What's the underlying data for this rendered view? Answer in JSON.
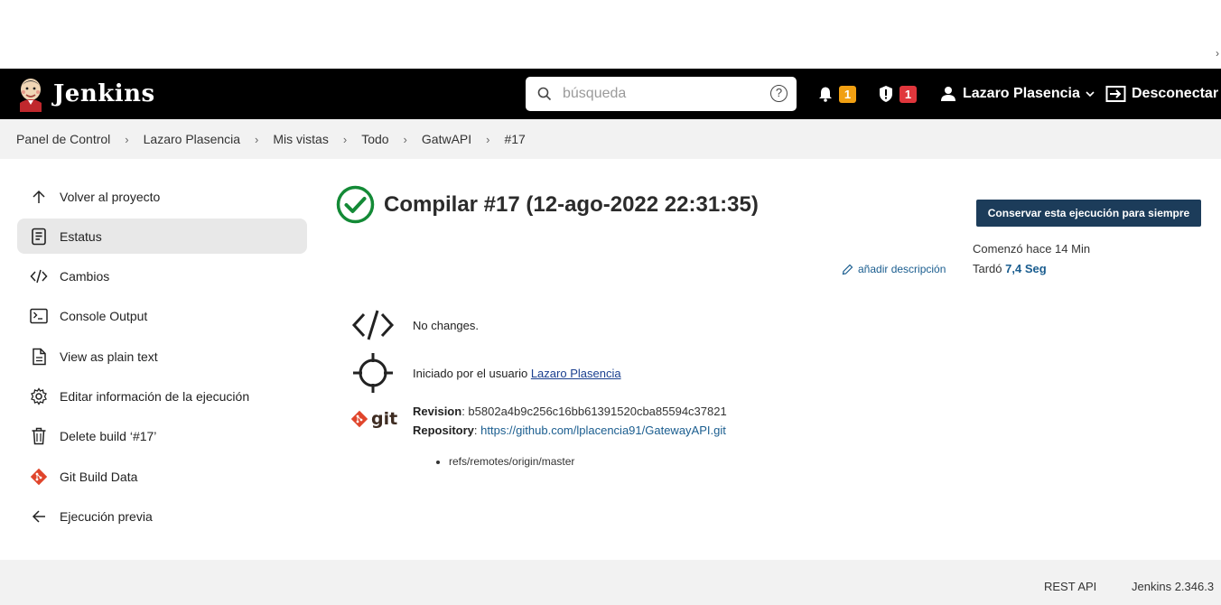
{
  "header": {
    "brand": "Jenkins",
    "search_placeholder": "búsqueda",
    "notifications_count": "1",
    "security_count": "1",
    "user_name": "Lazaro Plasencia",
    "logout_label": "Desconectar"
  },
  "breadcrumb": [
    "Panel de Control",
    "Lazaro Plasencia",
    "Mis vistas",
    "Todo",
    "GatwAPI",
    "#17"
  ],
  "sidebar": {
    "items": [
      {
        "label": "Volver al proyecto",
        "icon": "arrow-up-icon"
      },
      {
        "label": "Estatus",
        "icon": "document-icon"
      },
      {
        "label": "Cambios",
        "icon": "code-icon"
      },
      {
        "label": "Console Output",
        "icon": "terminal-icon"
      },
      {
        "label": "View as plain text",
        "icon": "file-text-icon"
      },
      {
        "label": "Editar información de la ejecución",
        "icon": "gear-icon"
      },
      {
        "label": "Delete build ‘#17’",
        "icon": "trash-icon"
      },
      {
        "label": "Git Build Data",
        "icon": "git-icon"
      },
      {
        "label": "Ejecución previa",
        "icon": "arrow-left-icon"
      }
    ]
  },
  "main": {
    "title": "Compilar #17 (12-ago-2022 22:31:35)",
    "add_description": "añadir descripción",
    "changes_text": "No changes.",
    "started_by_prefix": "Iniciado por el usuario",
    "started_by_user": "Lazaro Plasencia",
    "git": {
      "revision_label": "Revision",
      "revision": "b5802a4b9c256c16bb61391520cba85594c37821",
      "repository_label": "Repository",
      "repository": "https://github.com/lplacencia91/GatewayAPI.git",
      "refs": [
        "refs/remotes/origin/master"
      ],
      "logo_text": "git"
    }
  },
  "right_panel": {
    "keep_button": "Conservar esta ejecución para siempre",
    "started": "Comenzó hace 14 Min",
    "took_prefix": "Tardó",
    "took_value": "7,4 Seg"
  },
  "footer": {
    "rest_api": "REST API",
    "version": "Jenkins 2.346.3"
  },
  "colors": {
    "header_bg": "#000000",
    "success_green": "#138a36",
    "keep_button_bg": "#1c3c5a",
    "notification_badge": "#f1a012",
    "security_badge": "#e0363c",
    "link": "#1a5d8f"
  }
}
